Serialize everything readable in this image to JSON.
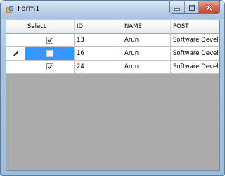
{
  "window": {
    "title": "Form1",
    "controls": {
      "minimize_icon": "minimize-icon",
      "maximize_icon": "maximize-icon",
      "close_icon": "close-icon"
    }
  },
  "grid": {
    "columns": [
      "Select",
      "ID",
      "NAME",
      "POST"
    ],
    "rows": [
      {
        "select": true,
        "id": "13",
        "name": "Arun",
        "post": "Software Develo...",
        "editing": false
      },
      {
        "select": false,
        "id": "16",
        "name": "Arun",
        "post": "Software Develo...",
        "editing": true
      },
      {
        "select": true,
        "id": "24",
        "name": "Arun",
        "post": "Software Develo...",
        "editing": false
      }
    ],
    "selection_color": "#3399ff",
    "background_color": "#ababab"
  }
}
